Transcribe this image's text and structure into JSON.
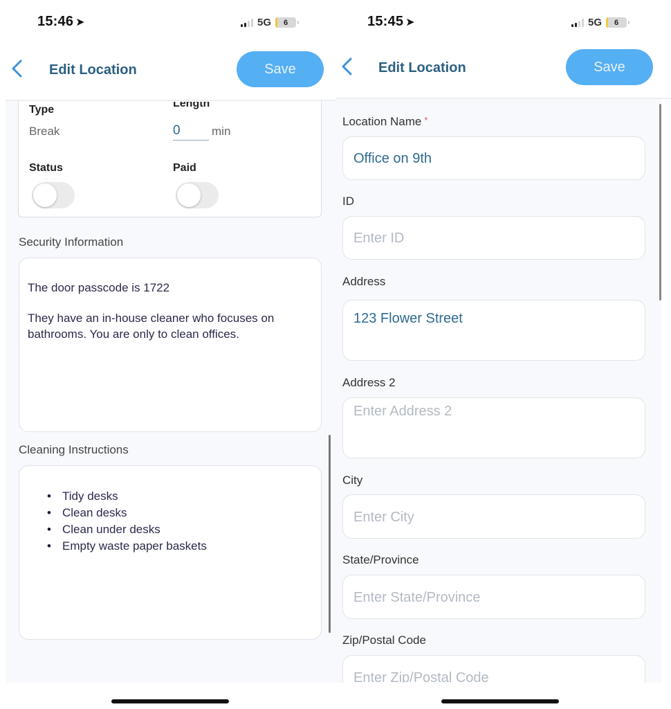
{
  "left": {
    "status_bar": {
      "time": "15:46",
      "network": "5G",
      "battery": "6"
    },
    "nav": {
      "title": "Edit Location",
      "save_label": "Save"
    },
    "break_card": {
      "type_label": "Type",
      "type_value": "Break",
      "length_label": "Length",
      "length_value": "0",
      "length_unit": "min",
      "status_label": "Status",
      "status_on": false,
      "paid_label": "Paid",
      "paid_on": false
    },
    "security": {
      "label": "Security Information",
      "paragraphs": [
        "The door passcode is 1722",
        "They have an in-house cleaner who focuses on bathrooms. You are only to clean offices."
      ]
    },
    "cleaning": {
      "label": "Cleaning Instructions",
      "items": [
        "Tidy desks",
        "Clean desks",
        "Clean under desks",
        "Empty waste paper baskets"
      ]
    }
  },
  "right": {
    "status_bar": {
      "time": "15:45",
      "network": "5G",
      "battery": "6"
    },
    "nav": {
      "title": "Edit Location",
      "save_label": "Save"
    },
    "fields": [
      {
        "label": "Location Name",
        "required": "*",
        "value": "Office on 9th",
        "placeholder": ""
      },
      {
        "label": "ID",
        "value": "",
        "placeholder": "Enter ID"
      },
      {
        "label": "Address",
        "value": "123 Flower Street",
        "placeholder": ""
      },
      {
        "label": "Address 2",
        "value": "",
        "placeholder": "Enter Address 2"
      },
      {
        "label": "City",
        "value": "",
        "placeholder": "Enter City"
      },
      {
        "label": "State/Province",
        "value": "",
        "placeholder": "Enter State/Province"
      },
      {
        "label": "Zip/Postal Code",
        "value": "",
        "placeholder": "Enter Zip/Postal Code"
      }
    ]
  },
  "colors": {
    "accent": "#55aff3",
    "title": "#2b5f82",
    "value_text": "#2f6a92",
    "required": "#e05252"
  }
}
